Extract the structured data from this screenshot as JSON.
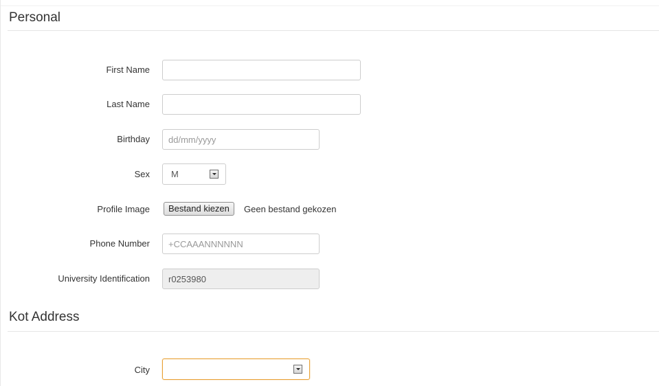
{
  "personal": {
    "section_title": "Personal",
    "first_name": {
      "label": "First Name",
      "value": "",
      "placeholder": ""
    },
    "last_name": {
      "label": "Last Name",
      "value": "",
      "placeholder": ""
    },
    "birthday": {
      "label": "Birthday",
      "value": "",
      "placeholder": "dd/mm/yyyy"
    },
    "sex": {
      "label": "Sex",
      "selected": "M",
      "icon": "chevron-down-icon"
    },
    "profile_image": {
      "label": "Profile Image",
      "button_label": "Bestand kiezen",
      "status": "Geen bestand gekozen"
    },
    "phone_number": {
      "label": "Phone Number",
      "value": "",
      "placeholder": "+CCAAANNNNNN"
    },
    "university_id": {
      "label": "University Identification",
      "value": "r0253980"
    }
  },
  "kot_address": {
    "section_title": "Kot Address",
    "city": {
      "label": "City",
      "selected": "",
      "icon": "chevron-down-icon"
    }
  },
  "colors": {
    "focus_border": "#e8a033",
    "readonly_background": "#eeeeee",
    "input_border": "#cccccc"
  }
}
